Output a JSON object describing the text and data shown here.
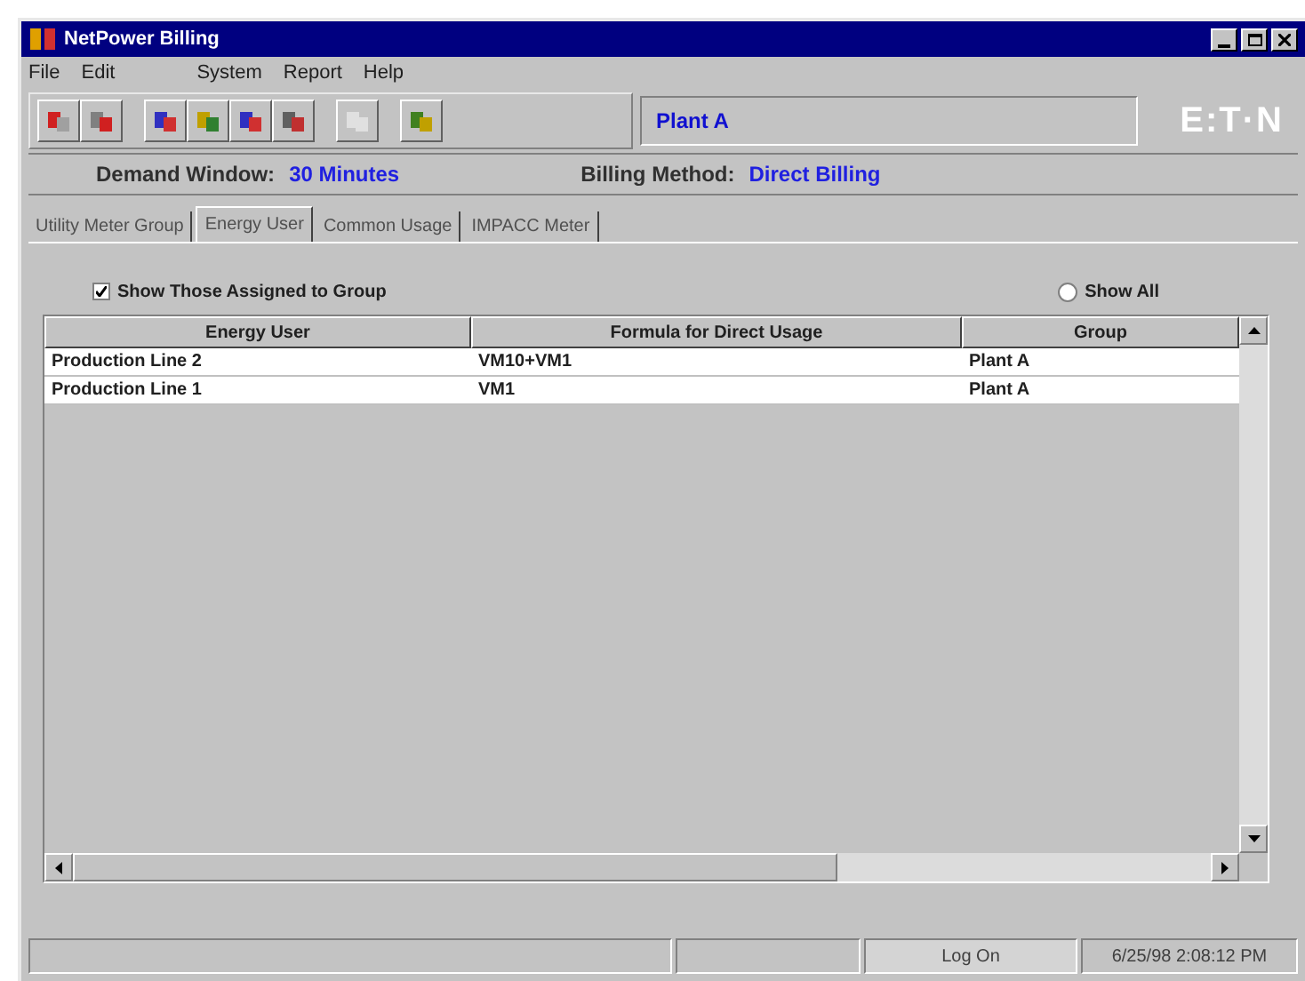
{
  "window": {
    "title": "NetPower Billing"
  },
  "menu": [
    {
      "label": "File"
    },
    {
      "label": "Edit"
    },
    {
      "label": "System"
    },
    {
      "label": "Report"
    },
    {
      "label": "Help"
    }
  ],
  "toolbar": {
    "plant": "Plant A",
    "logo": "E:T·N"
  },
  "info": {
    "demand_label": "Demand Window:",
    "demand_value": "30 Minutes",
    "billing_label": "Billing Method:",
    "billing_value": "Direct Billing"
  },
  "tabs": [
    {
      "label": "Utility Meter Group",
      "selected": false
    },
    {
      "label": "Energy User",
      "selected": true
    },
    {
      "label": "Common Usage",
      "selected": false
    },
    {
      "label": "IMPACC Meter",
      "selected": false
    }
  ],
  "filters": [
    {
      "label": "Show Those Assigned to Group",
      "selected": true
    },
    {
      "label": "Show All",
      "selected": false
    }
  ],
  "table": {
    "columns": [
      "Energy User",
      "Formula for Direct Usage",
      "Group"
    ],
    "rows": [
      [
        "Production Line 2",
        "VM10+VM1",
        "Plant A"
      ],
      [
        "Production Line 1",
        "VM1",
        "Plant A"
      ]
    ]
  },
  "status_bar": {
    "log": "Log On",
    "time": "6/25/98 2:08:12 PM"
  }
}
